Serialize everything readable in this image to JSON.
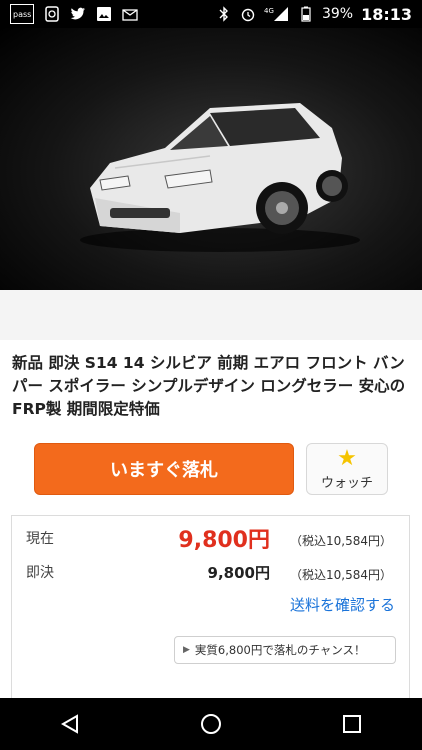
{
  "status_bar": {
    "left_icons": [
      "pass-icon",
      "app-icon",
      "twitter-icon",
      "image-icon",
      "mail-icon"
    ],
    "pass_label": "pass",
    "network_label": "4G",
    "battery_pct": "39%",
    "time": "18:13"
  },
  "listing": {
    "title": "新品 即決 S14 14 シルビア 前期 エアロ フロント バンパー スポイラー シンプルデザイン ロングセラー 安心のFRP製 期間限定特価"
  },
  "actions": {
    "buy_now_label": "いますぐ落札",
    "watch_label": "ウォッチ"
  },
  "price": {
    "current_label": "現在",
    "current_value": "9,800円",
    "current_tax": "（税込10,584円）",
    "buyout_label": "即決",
    "buyout_value": "9,800円",
    "buyout_tax": "（税込10,584円）",
    "shipping_link": "送料を確認する",
    "chance_text": "実質6,800円で落札のチャンス！"
  },
  "colors": {
    "buy_button": "#f36a1c",
    "price_red": "#e0301e",
    "link_blue": "#1a73d9",
    "star_yellow": "#f5c400"
  }
}
